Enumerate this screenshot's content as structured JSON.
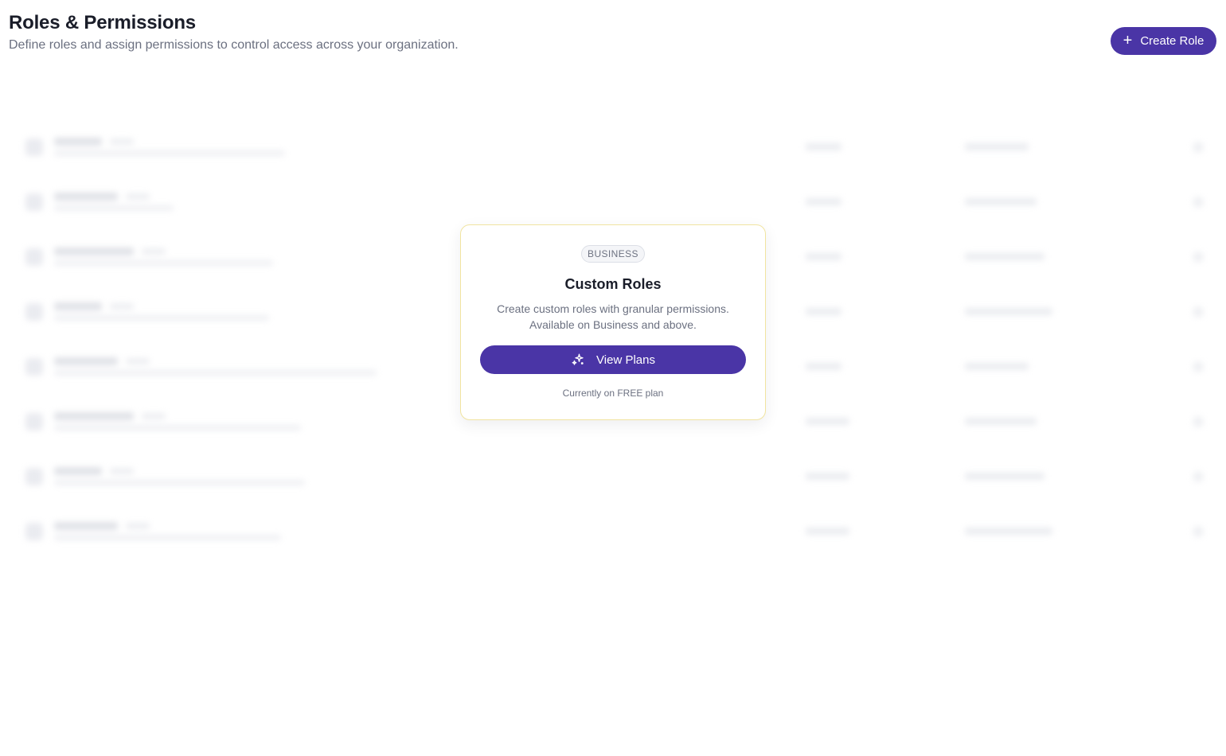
{
  "header": {
    "title": "Roles & Permissions",
    "subtitle": "Define roles and assign permissions to control access across your organization."
  },
  "toolbar": {
    "create_role_label": "Create Role",
    "create_role_icon": "plus-icon"
  },
  "upgrade_card": {
    "badge": "BUSINESS",
    "title": "Custom Roles",
    "desc_line1": "Create custom roles with granular permissions.",
    "desc_line2": "Available on Business and above.",
    "button_label": "View Plans",
    "button_icon": "sparkle-icon",
    "plan_note": "Currently on FREE plan"
  },
  "colors": {
    "accent": "#4a35a6",
    "card_border": "#f1e4a0"
  }
}
